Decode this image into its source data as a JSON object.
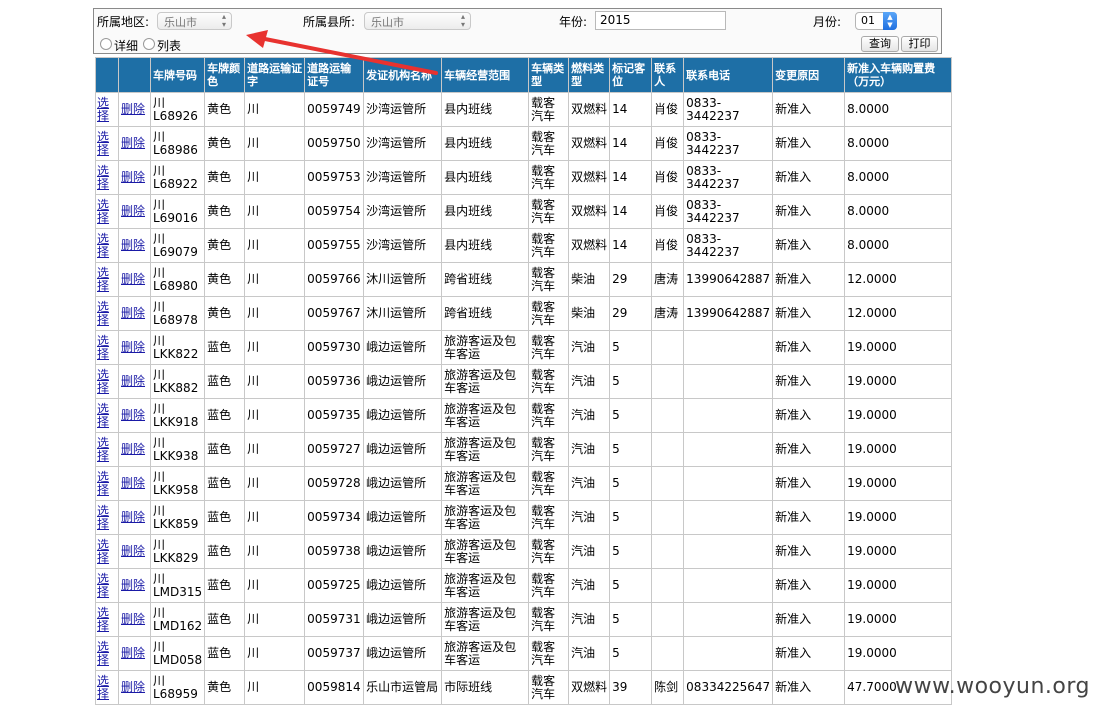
{
  "filters": {
    "region_label": "所属地区:",
    "region_value": "乐山市",
    "county_label": "所属县所:",
    "county_value": "乐山市",
    "year_label": "年份:",
    "year_value": "2015",
    "month_label": "月份:",
    "month_value": "01",
    "view_detail": "详细",
    "view_list": "列表",
    "query_button": "查询",
    "print_button": "打印"
  },
  "table": {
    "headers": [
      "",
      "",
      "车牌号码",
      "车牌颜色",
      "道路运输证字",
      "道路运输证号",
      "发证机构名称",
      "车辆经营范围",
      "车辆类型",
      "燃料类型",
      "标记客位",
      "联系人",
      "联系电话",
      "变更原因",
      "新准入车辆购置费（万元）"
    ],
    "rows": [
      [
        "选择",
        "删除",
        "川L68926",
        "黄色",
        "川",
        "0059749",
        "沙湾运管所",
        "县内班线",
        "载客汽车",
        "双燃料",
        "14",
        "肖俊",
        "0833-3442237",
        "新准入",
        "8.0000"
      ],
      [
        "选择",
        "删除",
        "川L68986",
        "黄色",
        "川",
        "0059750",
        "沙湾运管所",
        "县内班线",
        "载客汽车",
        "双燃料",
        "14",
        "肖俊",
        "0833-3442237",
        "新准入",
        "8.0000"
      ],
      [
        "选择",
        "删除",
        "川L68922",
        "黄色",
        "川",
        "0059753",
        "沙湾运管所",
        "县内班线",
        "载客汽车",
        "双燃料",
        "14",
        "肖俊",
        "0833-3442237",
        "新准入",
        "8.0000"
      ],
      [
        "选择",
        "删除",
        "川L69016",
        "黄色",
        "川",
        "0059754",
        "沙湾运管所",
        "县内班线",
        "载客汽车",
        "双燃料",
        "14",
        "肖俊",
        "0833-3442237",
        "新准入",
        "8.0000"
      ],
      [
        "选择",
        "删除",
        "川L69079",
        "黄色",
        "川",
        "0059755",
        "沙湾运管所",
        "县内班线",
        "载客汽车",
        "双燃料",
        "14",
        "肖俊",
        "0833-3442237",
        "新准入",
        "8.0000"
      ],
      [
        "选择",
        "删除",
        "川L68980",
        "黄色",
        "川",
        "0059766",
        "沐川运管所",
        "跨省班线",
        "载客汽车",
        "柴油",
        "29",
        "唐涛",
        "13990642887",
        "新准入",
        "12.0000"
      ],
      [
        "选择",
        "删除",
        "川L68978",
        "黄色",
        "川",
        "0059767",
        "沐川运管所",
        "跨省班线",
        "载客汽车",
        "柴油",
        "29",
        "唐涛",
        "13990642887",
        "新准入",
        "12.0000"
      ],
      [
        "选择",
        "删除",
        "川LKK822",
        "蓝色",
        "川",
        "0059730",
        "峨边运管所",
        "旅游客运及包车客运",
        "载客汽车",
        "汽油",
        "5",
        "",
        "",
        "新准入",
        "19.0000"
      ],
      [
        "选择",
        "删除",
        "川LKK882",
        "蓝色",
        "川",
        "0059736",
        "峨边运管所",
        "旅游客运及包车客运",
        "载客汽车",
        "汽油",
        "5",
        "",
        "",
        "新准入",
        "19.0000"
      ],
      [
        "选择",
        "删除",
        "川LKK918",
        "蓝色",
        "川",
        "0059735",
        "峨边运管所",
        "旅游客运及包车客运",
        "载客汽车",
        "汽油",
        "5",
        "",
        "",
        "新准入",
        "19.0000"
      ],
      [
        "选择",
        "删除",
        "川LKK938",
        "蓝色",
        "川",
        "0059727",
        "峨边运管所",
        "旅游客运及包车客运",
        "载客汽车",
        "汽油",
        "5",
        "",
        "",
        "新准入",
        "19.0000"
      ],
      [
        "选择",
        "删除",
        "川LKK958",
        "蓝色",
        "川",
        "0059728",
        "峨边运管所",
        "旅游客运及包车客运",
        "载客汽车",
        "汽油",
        "5",
        "",
        "",
        "新准入",
        "19.0000"
      ],
      [
        "选择",
        "删除",
        "川LKK859",
        "蓝色",
        "川",
        "0059734",
        "峨边运管所",
        "旅游客运及包车客运",
        "载客汽车",
        "汽油",
        "5",
        "",
        "",
        "新准入",
        "19.0000"
      ],
      [
        "选择",
        "删除",
        "川LKK829",
        "蓝色",
        "川",
        "0059738",
        "峨边运管所",
        "旅游客运及包车客运",
        "载客汽车",
        "汽油",
        "5",
        "",
        "",
        "新准入",
        "19.0000"
      ],
      [
        "选择",
        "删除",
        "川LMD315",
        "蓝色",
        "川",
        "0059725",
        "峨边运管所",
        "旅游客运及包车客运",
        "载客汽车",
        "汽油",
        "5",
        "",
        "",
        "新准入",
        "19.0000"
      ],
      [
        "选择",
        "删除",
        "川LMD162",
        "蓝色",
        "川",
        "0059731",
        "峨边运管所",
        "旅游客运及包车客运",
        "载客汽车",
        "汽油",
        "5",
        "",
        "",
        "新准入",
        "19.0000"
      ],
      [
        "选择",
        "删除",
        "川LMD058",
        "蓝色",
        "川",
        "0059737",
        "峨边运管所",
        "旅游客运及包车客运",
        "载客汽车",
        "汽油",
        "5",
        "",
        "",
        "新准入",
        "19.0000"
      ],
      [
        "选择",
        "删除",
        "川L68959",
        "黄色",
        "川",
        "0059814",
        "乐山市运管局",
        "市际班线",
        "载客汽车",
        "双燃料",
        "39",
        "陈剑",
        "08334225647",
        "新准入",
        "47.7000"
      ]
    ]
  },
  "watermark": "www.wooyun.org",
  "colors": {
    "header_bg": "#1e6fa6",
    "link": "#1a1aa6",
    "annotation_arrow": "#e8322f"
  }
}
